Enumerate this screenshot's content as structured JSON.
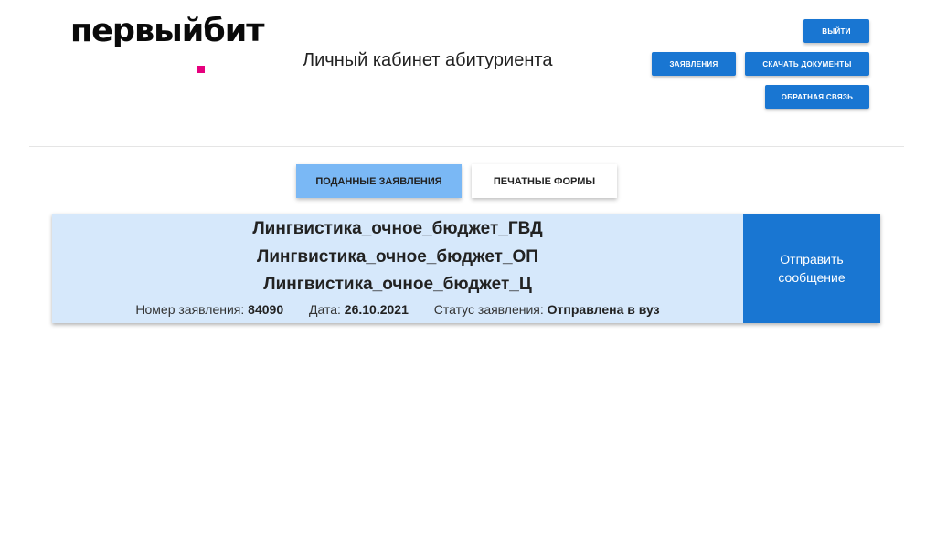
{
  "brand": {
    "logo_part1": "первый",
    "logo_part2": "бит",
    "accent_color": "#e6007e"
  },
  "header": {
    "title": "Личный кабинет абитуриента",
    "buttons": {
      "logout": "Выйти",
      "applications": "Заявления",
      "download_docs": "Скачать документы",
      "feedback": "Обратная связь"
    }
  },
  "tabs": [
    {
      "label": "Поданные заявления",
      "active": true
    },
    {
      "label": "Печатные формы",
      "active": false
    }
  ],
  "application": {
    "programs": [
      "Лингвистика_очное_бюджет_ГВД",
      "Лингвистика_очное_бюджет_ОП",
      "Лингвистика_очное_бюджет_Ц"
    ],
    "number_label": "Номер заявления:",
    "number": "84090",
    "date_label": "Дата:",
    "date": "26.10.2021",
    "status_label": "Статус заявления:",
    "status": "Отправлена в вуз",
    "send_message": "Отправить сообщение"
  },
  "colors": {
    "primary": "#1976d2",
    "tab_active": "#7ab8f5",
    "card_bg": "#d6e8fb"
  }
}
